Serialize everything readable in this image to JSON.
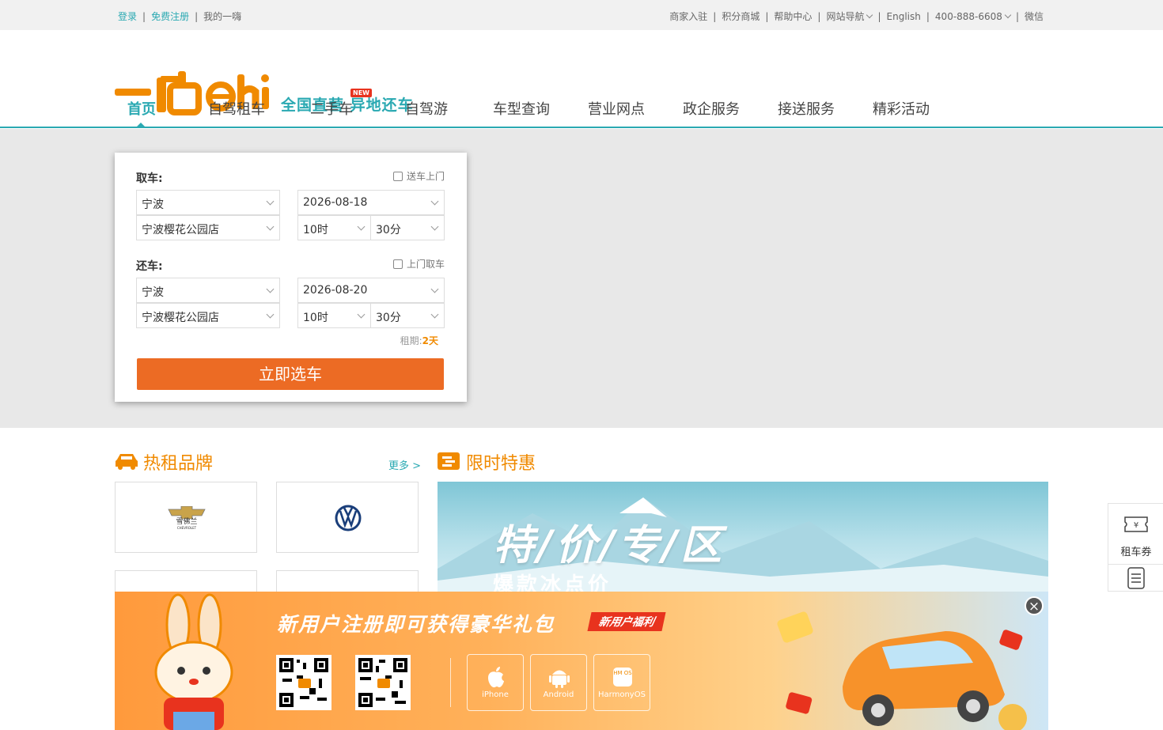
{
  "topbar": {
    "login": "登录",
    "register": "免费注册",
    "my": "我的一嗨",
    "merchant": "商家入驻",
    "points": "积分商城",
    "help": "帮助中心",
    "sitenav": "网站导航",
    "english": "English",
    "phone": "400-888-6608",
    "wechat": "微信"
  },
  "header": {
    "slogan": "全国直营 异地还车"
  },
  "nav": {
    "items": [
      "首页",
      "自驾租车",
      "二手车",
      "自驾游",
      "车型查询",
      "营业网点",
      "政企服务",
      "接送服务",
      "精彩活动"
    ],
    "new_badge": "NEW"
  },
  "booking": {
    "pickup_label": "取车:",
    "pickup_delivery": "送车上门",
    "pickup_city": "宁波",
    "pickup_store": "宁波樱花公园店",
    "pickup_date": "2026-08-18",
    "pickup_hour": "10时",
    "pickup_min": "30分",
    "return_label": "还车:",
    "return_pickup": "上门取车",
    "return_city": "宁波",
    "return_store": "宁波樱花公园店",
    "return_date": "2026-08-20",
    "return_hour": "10时",
    "return_min": "30分",
    "period_label": "租期:",
    "period_value": "2天",
    "submit": "立即选车"
  },
  "brands": {
    "title": "热租品牌",
    "more": "更多 >",
    "chevrolet_cn": "雪佛兰",
    "chevrolet_en": "CHEVROLET"
  },
  "promo": {
    "title": "限时特惠",
    "banner_title": "特/价/专/区",
    "banner_sub": "爆款冰点价"
  },
  "side": {
    "coupon": "租车券"
  },
  "popup": {
    "headline": "新用户注册即可获得豪华礼包",
    "tag": "新用户福利",
    "apps": [
      "iPhone",
      "Android",
      "HarmonyOS"
    ],
    "harmony_icon": "HM OS"
  },
  "colors": {
    "teal": "#2aa9b2",
    "orange": "#f08a00",
    "button": "#ec6b24"
  }
}
